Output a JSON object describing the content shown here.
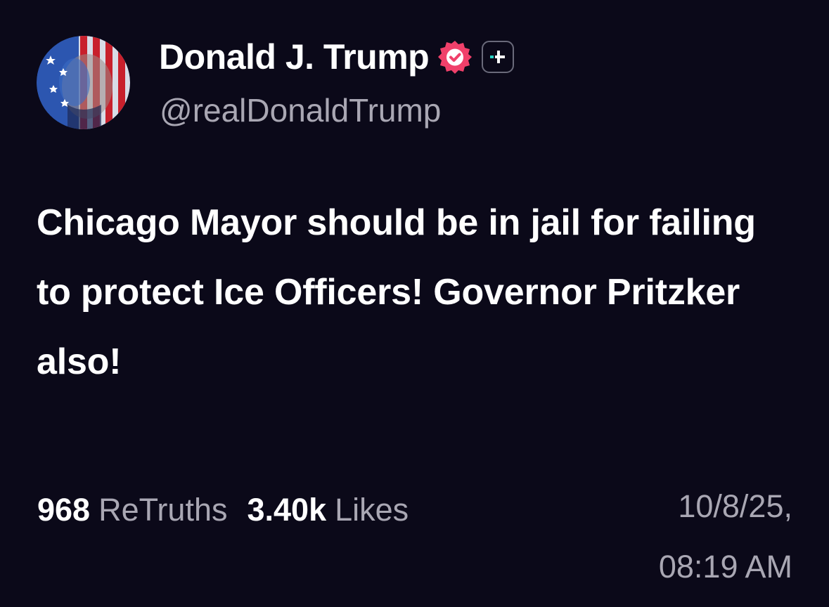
{
  "author": {
    "display_name": "Donald J. Trump",
    "handle": "@realDonaldTrump",
    "verified": true,
    "avatar_icon": "avatar-flag-portrait",
    "follow_icon": "follow-plus-icon"
  },
  "post": {
    "text": "Chicago Mayor should be in jail for failing to protect Ice Officers! Governor Pritzker also!"
  },
  "stats": {
    "retruths_count": "968",
    "retruths_label": "ReTruths",
    "likes_count": "3.40k",
    "likes_label": "Likes"
  },
  "timestamp": {
    "date": "10/8/25,",
    "time": "08:19 AM"
  },
  "colors": {
    "background": "#0b0919",
    "primary_text": "#ffffff",
    "secondary_text": "#a9a7b3",
    "verified_badge": "#f0406a",
    "follow_accent": "#27d3c3"
  }
}
